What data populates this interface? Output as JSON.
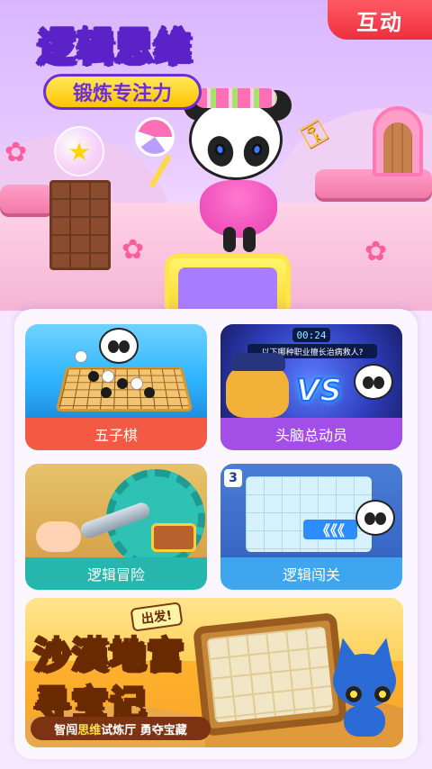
{
  "hero": {
    "title": "逻辑思维",
    "subtitle": "锻炼专注力",
    "interact_button": "互动"
  },
  "cards": [
    {
      "label": "五子棋",
      "color": "#f25a45"
    },
    {
      "label": "头脑总动员",
      "color": "#a34ee6",
      "timer": "00:24",
      "question": "以下哪种职业擅长治病救人?",
      "badge": "VS"
    },
    {
      "label": "逻辑冒险",
      "color": "#27b6ad"
    },
    {
      "label": "逻辑闯关",
      "color": "#3ea6ee",
      "level": "3",
      "arrows": "《《《"
    }
  ],
  "banner": {
    "badge": "出发!",
    "title_line1": "沙漠地宫",
    "title_line2": "寻宝记",
    "tagline_pre": "智闯",
    "tagline_highlight": "思维",
    "tagline_post": "试炼厅 勇夺宝藏"
  }
}
